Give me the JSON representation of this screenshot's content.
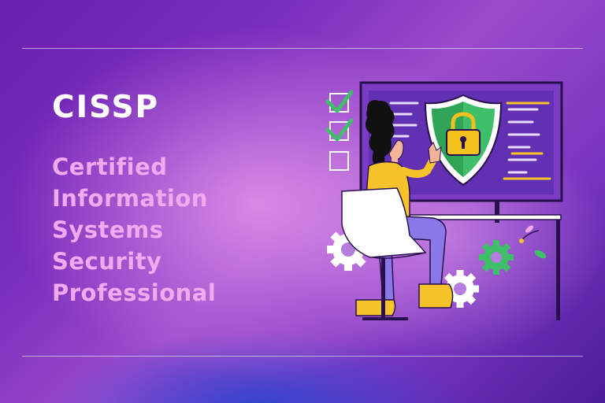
{
  "heading": {
    "title": "CISSP",
    "subtitle_lines": [
      "Certified",
      "Information",
      "Systems",
      "Security",
      "Professional"
    ]
  },
  "illustration": {
    "icons": [
      "checkmark-icon",
      "checkmark-icon",
      "empty-checkbox-icon",
      "shield-lock-icon",
      "gear-icon",
      "gear-icon",
      "gear-icon"
    ],
    "colors": {
      "shield": "#3fbf6a",
      "lock": "#f2c11d",
      "monitor": "#7a3cc4",
      "shirt": "#f6c42a",
      "pants": "#8a78e6",
      "hair": "#111111",
      "check": "#3fbf6a"
    }
  }
}
